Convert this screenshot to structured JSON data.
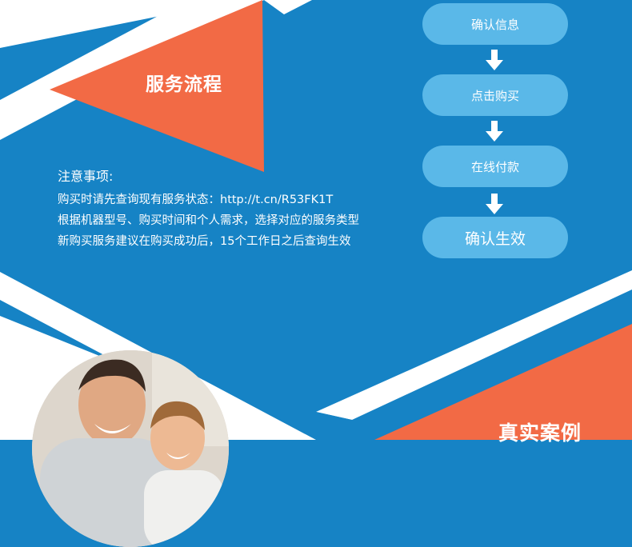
{
  "service": {
    "title": "服务流程",
    "notes_heading": "注意事项:",
    "notes": [
      "购买时请先查询现有服务状态：http://t.cn/R53FK1T",
      "根据机器型号、购买时间和个人需求，选择对应的服务类型",
      "新购买服务建议在购买成功后，15个工作日之后查询生效"
    ]
  },
  "flow": {
    "steps": [
      "确认信息",
      "点击购买",
      "在线付款",
      "确认生效"
    ]
  },
  "cases": {
    "title": "真实案例"
  },
  "colors": {
    "background_blue": "#1683c5",
    "accent_orange": "#f26a45",
    "step_pill": "#5ab8e8",
    "band_white": "#ffffff"
  }
}
